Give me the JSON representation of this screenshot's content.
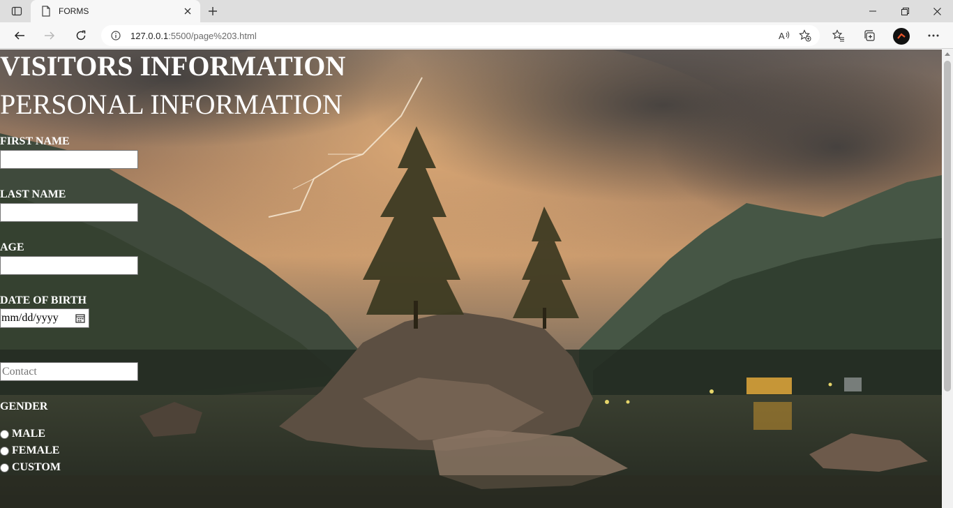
{
  "browser": {
    "tab_title": "FORMS",
    "url_host": "127.0.0.1",
    "url_rest": ":5500/page%203.html"
  },
  "page": {
    "heading": "VISITORS INFORMATION",
    "subheading": "PERSONAL INFORMATION",
    "first_name_label": "FIRST NAME",
    "first_name_value": "",
    "last_name_label": "LAST NAME",
    "last_name_value": "",
    "age_label": "AGE",
    "age_value": "",
    "dob_label": "DATE OF BIRTH",
    "dob_value": "mm/dd/yyyy",
    "contact_placeholder": "Contact",
    "gender_label": "GENDER",
    "gender_options": [
      "MALE",
      "FEMALE",
      "CUSTOM"
    ]
  }
}
